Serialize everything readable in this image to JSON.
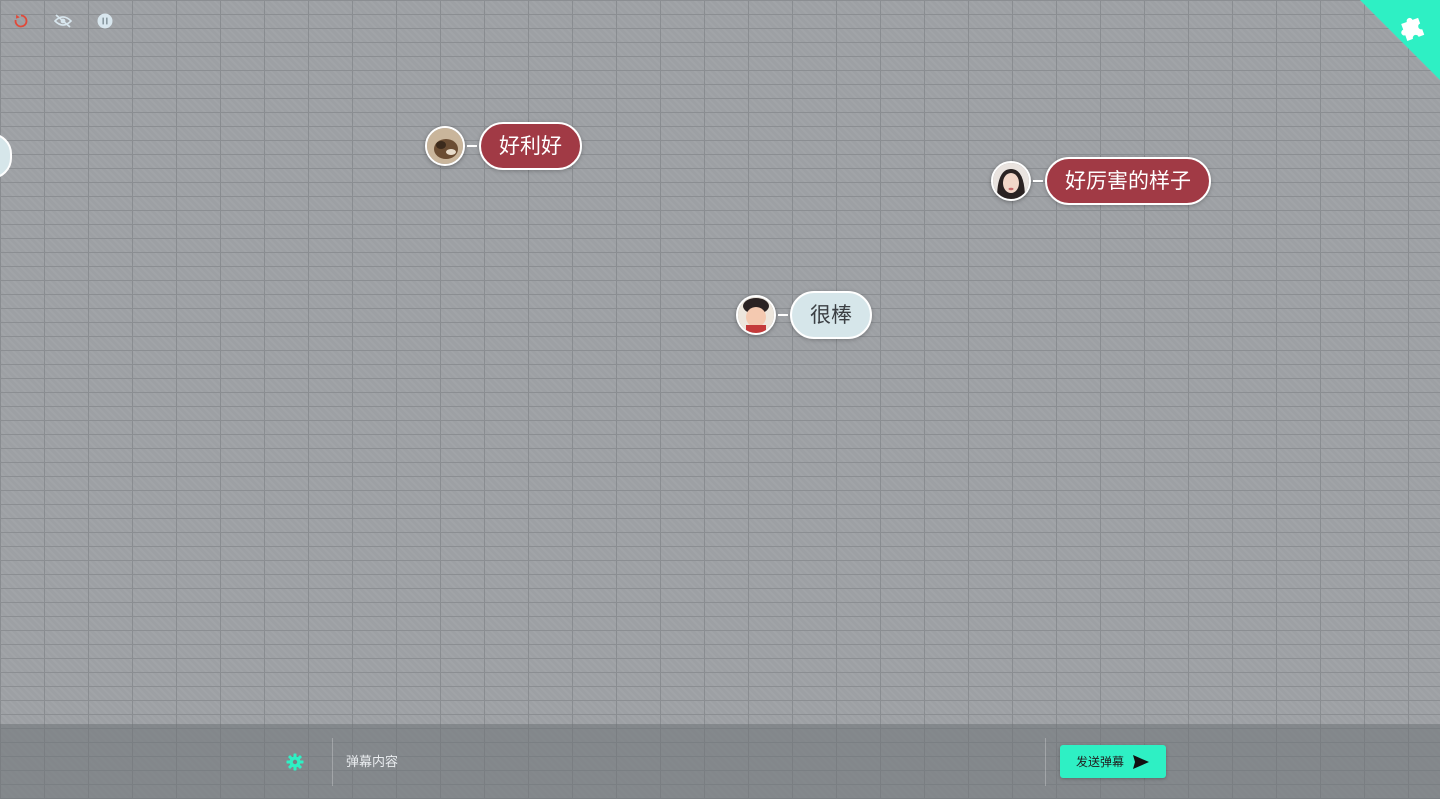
{
  "toolbar": {
    "refresh_icon": "refresh-icon",
    "hide_icon": "eye-off-icon",
    "pause_icon": "pause-icon"
  },
  "corner": {
    "icon": "puzzle-icon",
    "color": "#2ef0c4"
  },
  "danmaku": [
    {
      "text": "好利好",
      "style": "red",
      "avatar": "dog-photo"
    },
    {
      "text": "好厉害的样子",
      "style": "red",
      "avatar": "girl-photo"
    },
    {
      "text": "很棒",
      "style": "light",
      "avatar": "child-photo"
    }
  ],
  "input": {
    "placeholder": "弹幕内容",
    "value": ""
  },
  "send_button": {
    "label": "发送弹幕",
    "icon": "send-icon"
  },
  "settings_icon": "gear-icon",
  "colors": {
    "accent": "#2ef0c4",
    "bubble_red": "#a13a45",
    "bubble_light": "#d6e6ea",
    "background": "#9da0a4"
  }
}
